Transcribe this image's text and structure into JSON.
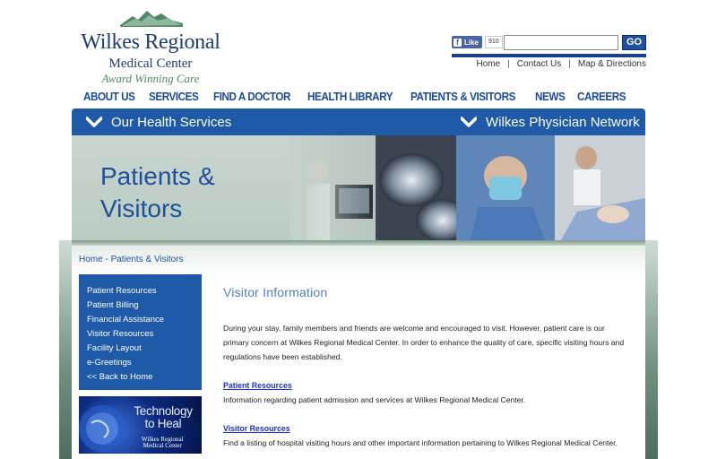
{
  "logo": {
    "title": "Wilkes Regional",
    "subtitle": "Medical Center",
    "tagline": "Award Winning Care"
  },
  "social": {
    "like_label": "Like",
    "like_count": "910"
  },
  "search": {
    "value": "",
    "placeholder": "",
    "button_label": "GO"
  },
  "utility_links": [
    "Home",
    "Contact Us",
    "Map & Directions"
  ],
  "main_nav": [
    "ABOUT US",
    "SERVICES",
    "FIND A DOCTOR",
    "HEALTH LIBRARY",
    "PATIENTS & VISITORS",
    "NEWS",
    "CAREERS"
  ],
  "services_bar": {
    "left": "Our Health Services",
    "right": "Wilkes Physician Network"
  },
  "banner": {
    "title": "Patients &\nVisitors"
  },
  "breadcrumb": {
    "home": "Home",
    "separator": " - ",
    "current": "Patients & Visitors"
  },
  "sidebar": {
    "items": [
      "Patient Resources",
      "Patient Billing",
      "Financial Assistance",
      "Visitor Resources",
      "Facility Layout",
      "e-Greetings",
      "<< Back to Home"
    ],
    "promo": {
      "title": "Technology\nto Heal",
      "logo": "Wilkes Regional\nMedical Center"
    }
  },
  "main": {
    "heading": "Visitor Information",
    "intro": "During your stay, family members and friends are welcome and encouraged to visit. However, patient care is our primary concern at Wilkes Regional Medical Center. In order to enhance the quality of care, specific visiting hours and regulations have been established.",
    "sections": [
      {
        "link": "Patient Resources",
        "text": "Information regarding patient admission and services at Wilkes Regional Medical Center."
      },
      {
        "link": "Visitor Resources",
        "text": "Find a listing of hospital visiting hours and other important information pertaining to Wilkes Regional Medical Center."
      }
    ]
  },
  "colors": {
    "brand_blue": "#1e5aa8",
    "nav_blue": "#1a4a9a",
    "heading_blue": "#4f7fc2",
    "link_blue": "#1a2fd6",
    "logo_green": "#4f8a66"
  }
}
